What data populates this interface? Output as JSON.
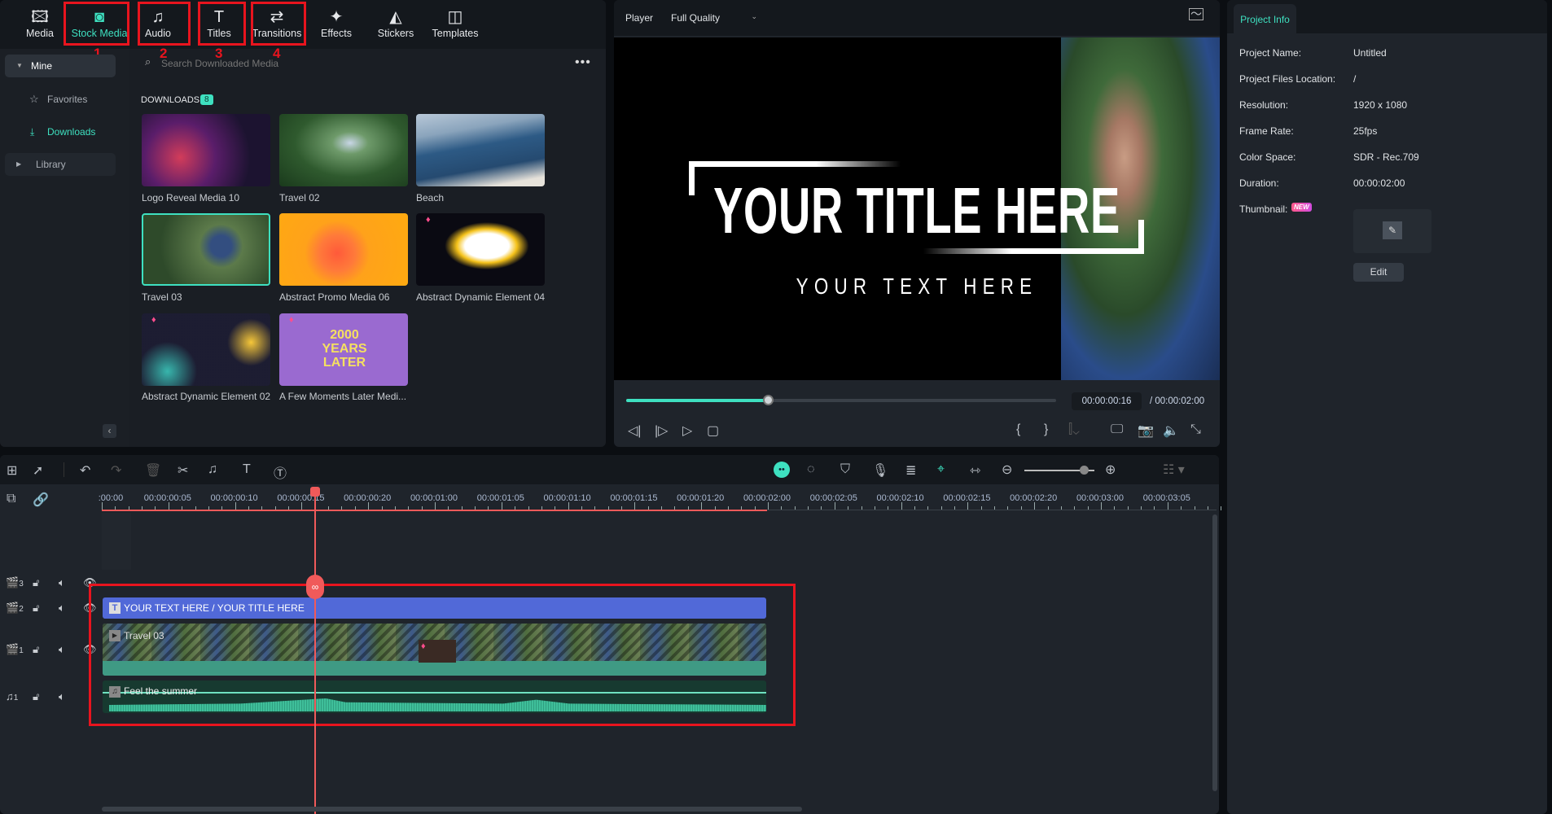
{
  "toolbar": {
    "items": [
      {
        "label": "Media",
        "icon": "media-icon"
      },
      {
        "label": "Stock Media",
        "icon": "stock-media-icon",
        "active": true,
        "marker": "1"
      },
      {
        "label": "Audio",
        "icon": "music-note-icon",
        "marker": "2"
      },
      {
        "label": "Titles",
        "icon": "text-icon",
        "marker": "3"
      },
      {
        "label": "Transitions",
        "icon": "transitions-icon",
        "marker": "4"
      },
      {
        "label": "Effects",
        "icon": "effects-icon"
      },
      {
        "label": "Stickers",
        "icon": "stickers-icon"
      },
      {
        "label": "Templates",
        "icon": "templates-icon"
      }
    ]
  },
  "sidebar": {
    "mine": "Mine",
    "favorites": "Favorites",
    "downloads": "Downloads",
    "library": "Library"
  },
  "search": {
    "placeholder": "Search Downloaded Media"
  },
  "downloads": {
    "heading": "DOWNLOADS",
    "count": "8",
    "items": [
      {
        "name": "Logo Reveal Media 10"
      },
      {
        "name": "Travel 02"
      },
      {
        "name": "Beach"
      },
      {
        "name": "Travel 03"
      },
      {
        "name": "Abstract Promo Media 06"
      },
      {
        "name": "Abstract Dynamic Element 04"
      },
      {
        "name": "Abstract Dynamic Element 02"
      },
      {
        "name": "A Few Moments Later Medi...",
        "overlay": "2000 YEARS LATER"
      }
    ]
  },
  "player": {
    "label": "Player",
    "quality": "Full Quality",
    "title_text": "YOUR TITLE HERE",
    "sub_text": "YOUR TEXT HERE",
    "current_time": "00:00:00:16",
    "total_time": "/ 00:00:02:00",
    "progress": 0.33
  },
  "project_info": {
    "tab": "Project Info",
    "rows": [
      {
        "label": "Project Name:",
        "value": "Untitled"
      },
      {
        "label": "Project Files Location:",
        "value": "/"
      },
      {
        "label": "Resolution:",
        "value": "1920 x 1080"
      },
      {
        "label": "Frame Rate:",
        "value": "25fps"
      },
      {
        "label": "Color Space:",
        "value": "SDR - Rec.709"
      },
      {
        "label": "Duration:",
        "value": "00:00:02:00"
      }
    ],
    "thumbnail_label": "Thumbnail:",
    "new_badge": "NEW",
    "edit": "Edit"
  },
  "timeline": {
    "ruler": [
      ":00:00",
      "00:00:00:05",
      "00:00:00:10",
      "00:00:00:15",
      "00:00:00:20",
      "00:00:01:00",
      "00:00:01:05",
      "00:00:01:10",
      "00:00:01:15",
      "00:00:01:20",
      "00:00:02:00",
      "00:00:02:05",
      "00:00:02:10",
      "00:00:02:15",
      "00:00:02:20",
      "00:00:03:00",
      "00:00:03:05"
    ],
    "tracks": [
      "3",
      "2",
      "1",
      "1"
    ],
    "title_clip": "YOUR TEXT HERE / YOUR TITLE HERE",
    "video_clip": "Travel 03",
    "audio_clip": "Feel the summer",
    "zoom_level": 0.85
  },
  "colors": {
    "accent": "#3ee0c0",
    "highlight": "#e8141e",
    "playhead": "#f05a5a",
    "title_clip": "#5169d8",
    "audio_clip": "#3fbf9a"
  }
}
